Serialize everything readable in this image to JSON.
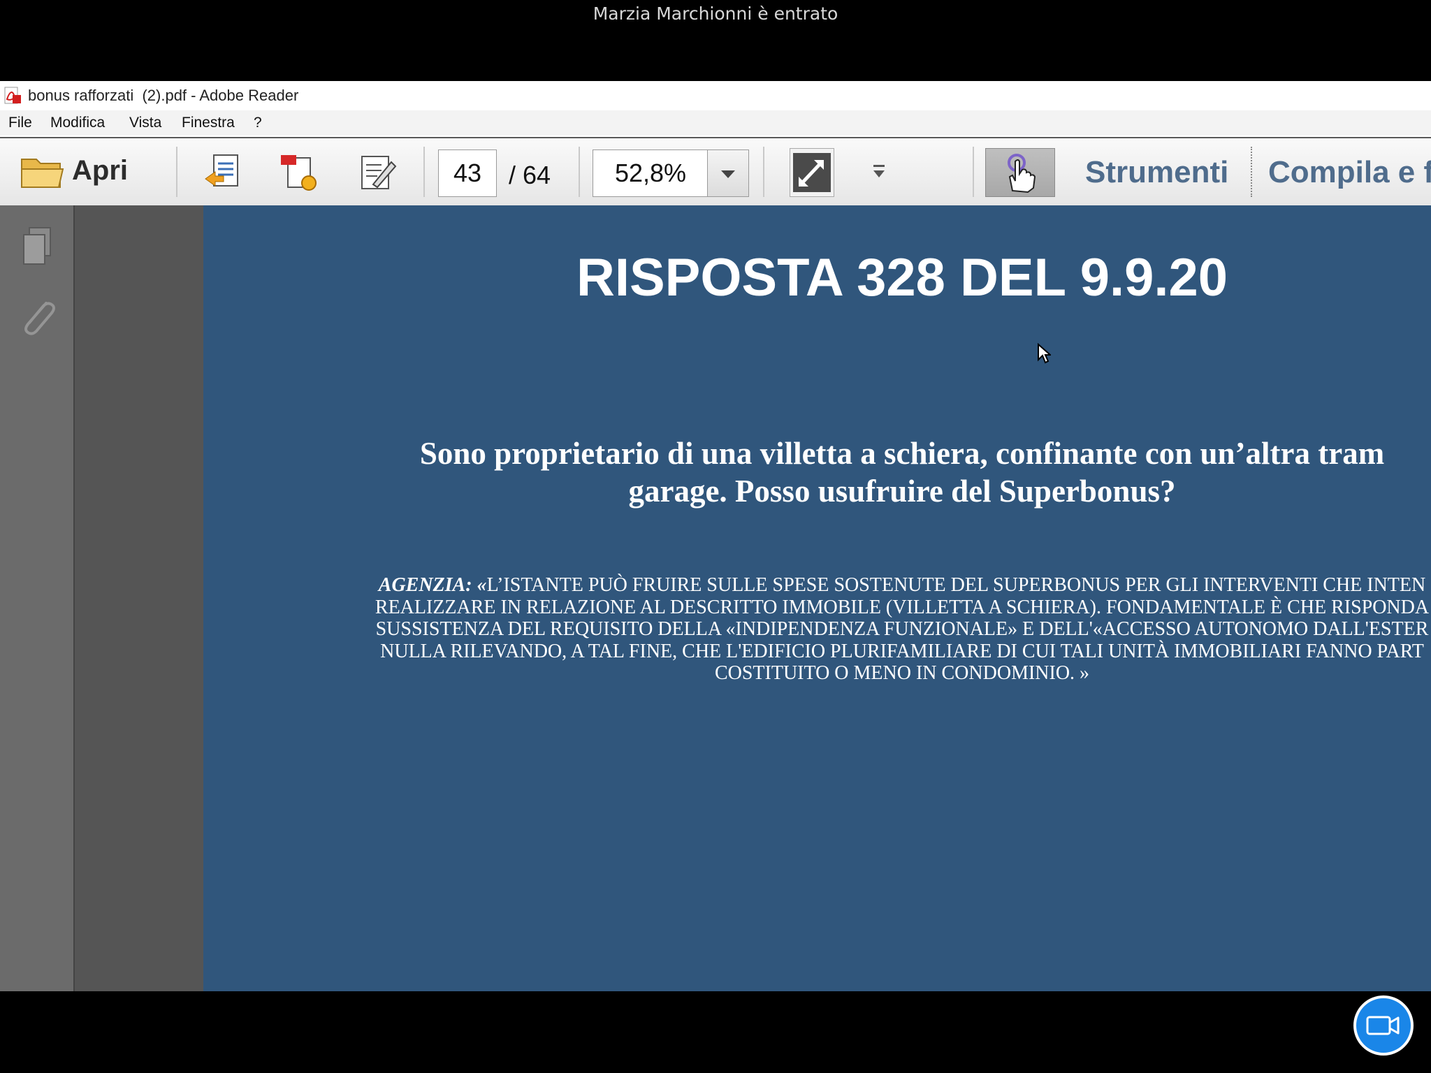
{
  "notification": {
    "text": "Marzia Marchionni è entrato"
  },
  "window": {
    "title": "bonus rafforzati  (2).pdf - Adobe Reader"
  },
  "menu": [
    "File",
    "Modifica",
    "Vista",
    "Finestra",
    "?"
  ],
  "toolbar": {
    "open_label": "Apri",
    "page_current": "43",
    "page_total": "/  64",
    "zoom": "52,8%",
    "tools_label": "Strumenti",
    "fill_label": "Compila e firma"
  },
  "slide": {
    "title": "RISPOSTA 328 DEL 9.9.20",
    "question": [
      "Sono proprietario di una villetta a schiera, confinante con un’altra tramite il garage. Posso usufruire del Superbonus?"
    ],
    "question_lines": [
      "Sono proprietario di una villetta a schiera, confinante con un’altra tram",
      "garage. Posso usufruire del Superbonus?"
    ],
    "answer_label": "AGENZIA: «",
    "answer_lines": [
      "L’ISTANTE PUÒ FRUIRE SULLE SPESE SOSTENUTE DEL SUPERBONUS PER GLI INTERVENTI CHE INTEN",
      "REALIZZARE IN RELAZIONE AL DESCRITTO IMMOBILE (VILLETTA A SCHIERA). FONDAMENTALE È CHE RISPONDA",
      "SUSSISTENZA DEL REQUISITO DELLA «INDIPENDENZA FUNZIONALE» E DELL'«ACCESSO AUTONOMO DALL'ESTER",
      "NULLA RILEVANDO, A TAL FINE, CHE L'EDIFICIO PLURIFAMILIARE DI CUI TALI UNITÀ IMMOBILIARI FANNO PART",
      "COSTITUITO O MENO IN CONDOMINIO.  »"
    ]
  },
  "colors": {
    "slide_bg": "#30567c",
    "accent": "#1a86e8",
    "link": "#4f6c8c"
  }
}
